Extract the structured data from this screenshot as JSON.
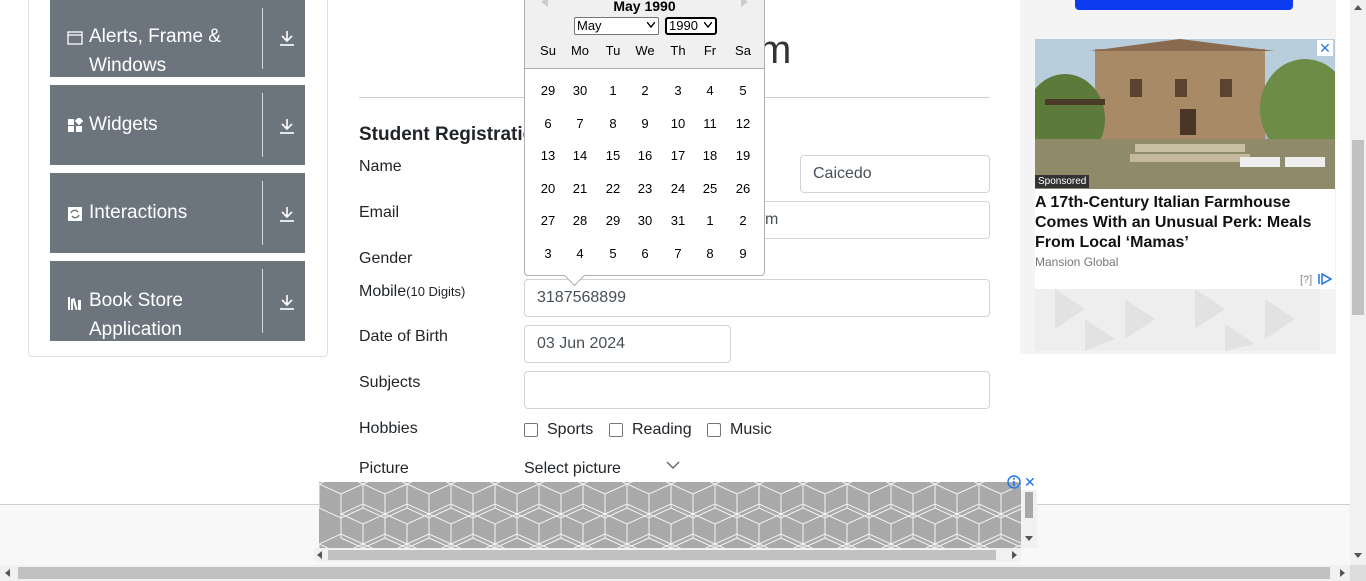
{
  "sidebar": {
    "items": [
      {
        "label_line1": "Alerts, Frame &",
        "label_line2": "Windows",
        "icon": "window-icon"
      },
      {
        "label": "Widgets",
        "icon": "widgets-icon"
      },
      {
        "label": "Interactions",
        "icon": "interactions-icon"
      },
      {
        "label_line1": "Book Store",
        "label_line2": "Application",
        "icon": "books-icon"
      }
    ]
  },
  "form": {
    "header_partial": "m",
    "title": "Student Registratio",
    "labels": {
      "name": "Name",
      "email": "Email",
      "gender": "Gender",
      "mobile": "Mobile",
      "mobile_hint": "(10 Digits)",
      "dob": "Date of Birth",
      "subjects": "Subjects",
      "hobbies": "Hobbies",
      "picture": "Picture"
    },
    "last_name_value": "Caicedo",
    "email_partial": "m",
    "mobile_value": "3187568899",
    "dob_value": "03 Jun 2024",
    "subjects_value": "",
    "hobbies": [
      "Sports",
      "Reading",
      "Music"
    ],
    "picture_select": "Select picture"
  },
  "datepicker": {
    "header": "May 1990",
    "month_selected": "May",
    "year_selected": "1990",
    "day_names": [
      "Su",
      "Mo",
      "Tu",
      "We",
      "Th",
      "Fr",
      "Sa"
    ],
    "weeks": [
      [
        "29",
        "30",
        "1",
        "2",
        "3",
        "4",
        "5"
      ],
      [
        "6",
        "7",
        "8",
        "9",
        "10",
        "11",
        "12"
      ],
      [
        "13",
        "14",
        "15",
        "16",
        "17",
        "18",
        "19"
      ],
      [
        "20",
        "21",
        "22",
        "23",
        "24",
        "25",
        "26"
      ],
      [
        "27",
        "28",
        "29",
        "30",
        "31",
        "1",
        "2"
      ],
      [
        "3",
        "4",
        "5",
        "6",
        "7",
        "8",
        "9"
      ]
    ]
  },
  "ad": {
    "sponsored": "Sponsored",
    "title": "A 17th-Century Italian Farmhouse Comes With an Unusual Perk: Meals From Local ‘Mamas’",
    "source": "Mansion Global",
    "info": "[?]",
    "close": "✕"
  },
  "bottom_ad": {
    "close": "✕"
  }
}
